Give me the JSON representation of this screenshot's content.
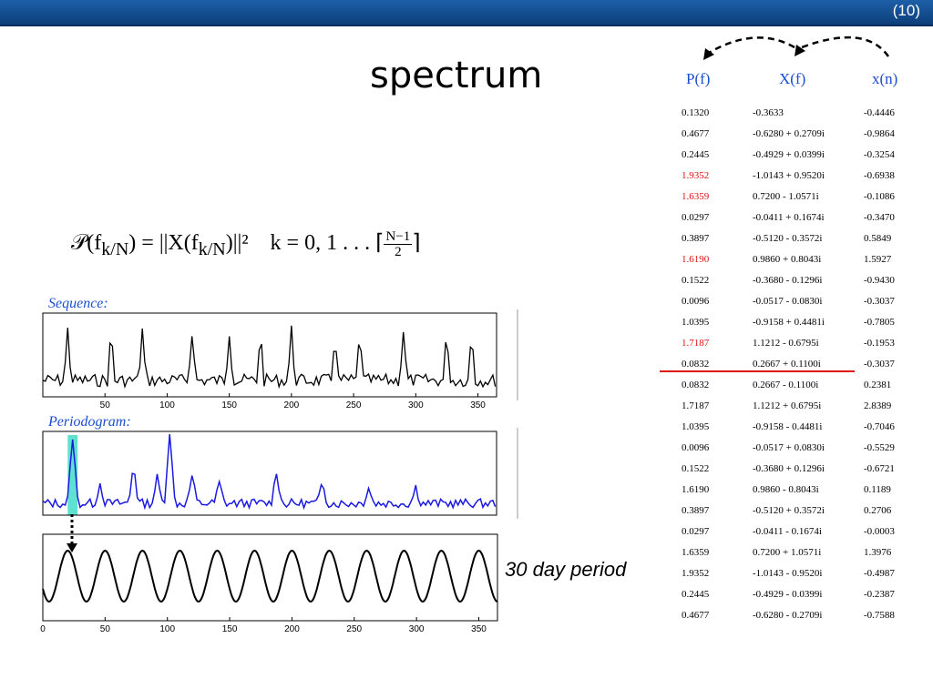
{
  "slide_number": "(10)",
  "title": "spectrum",
  "formula": {
    "lhs": "𝒫(f",
    "lhs_sub": "k/N",
    "mid": ") = ||X(f",
    "mid_sub": "k/N",
    "rhs": ")||²",
    "k_text": "k = 0, 1 . . . ⌈",
    "frac_num": "N−1",
    "frac_den": "2",
    "close": "⌉"
  },
  "sequence_label": "Sequence:",
  "periodogram_label": "Periodogram:",
  "caption": "30 day period",
  "table": {
    "headers": [
      "P(f)",
      "X(f)",
      "x(n)"
    ],
    "highlight_rows": [
      3,
      4,
      7,
      11
    ],
    "rows": [
      [
        "0.1320",
        "-0.3633",
        "-0.4446"
      ],
      [
        "0.4677",
        "-0.6280 + 0.2709i",
        "-0.9864"
      ],
      [
        "0.2445",
        "-0.4929 + 0.0399i",
        "-0.3254"
      ],
      [
        "1.9352",
        "-1.0143 + 0.9520i",
        "-0.6938"
      ],
      [
        "1.6359",
        "0.7200 - 1.0571i",
        "-0.1086"
      ],
      [
        "0.0297",
        "-0.0411 + 0.1674i",
        "-0.3470"
      ],
      [
        "0.3897",
        "-0.5120 - 0.3572i",
        "0.5849"
      ],
      [
        "1.6190",
        "0.9860 + 0.8043i",
        "1.5927"
      ],
      [
        "0.1522",
        "-0.3680 - 0.1296i",
        "-0.9430"
      ],
      [
        "0.0096",
        "-0.0517 - 0.0830i",
        "-0.3037"
      ],
      [
        "1.0395",
        "-0.9158 + 0.4481i",
        "-0.7805"
      ],
      [
        "1.7187",
        "1.1212 - 0.6795i",
        "-0.1953"
      ],
      [
        "0.0832",
        "0.2667 + 0.1100i",
        "-0.3037"
      ],
      [
        "0.0832",
        "0.2667 - 0.1100i",
        "0.2381"
      ],
      [
        "1.7187",
        "1.1212 + 0.6795i",
        "2.8389"
      ],
      [
        "1.0395",
        "-0.9158 - 0.4481i",
        "-0.7046"
      ],
      [
        "0.0096",
        "-0.0517 + 0.0830i",
        "-0.5529"
      ],
      [
        "0.1522",
        "-0.3680 + 0.1296i",
        "-0.6721"
      ],
      [
        "1.6190",
        "0.9860 - 0.8043i",
        "0.1189"
      ],
      [
        "0.3897",
        "-0.5120 + 0.3572i",
        "0.2706"
      ],
      [
        "0.0297",
        "-0.0411 - 0.1674i",
        "-0.0003"
      ],
      [
        "1.6359",
        "0.7200 + 1.0571i",
        "1.3976"
      ],
      [
        "1.9352",
        "-1.0143 - 0.9520i",
        "-0.4987"
      ],
      [
        "0.2445",
        "-0.4929 - 0.0399i",
        "-0.2387"
      ],
      [
        "0.4677",
        "-0.6280 - 0.2709i",
        "-0.7588"
      ]
    ]
  },
  "colors": {
    "header_blue": "#1a4fd0",
    "highlight_red": "#e01010",
    "periodogram_line": "#1a1ae0",
    "highlight_band": "#60e0d0"
  },
  "chart_data": [
    {
      "type": "line",
      "name_label": "Sequence:",
      "xlim": [
        0,
        365
      ],
      "x_ticks": [
        50,
        100,
        150,
        200,
        250,
        300,
        350
      ],
      "series": [
        {
          "peaks_x": [
            20,
            55,
            80,
            120,
            150,
            175,
            200,
            235,
            255,
            290,
            325,
            345
          ]
        }
      ]
    },
    {
      "type": "line",
      "name_label": "Periodogram:",
      "xlim": [
        0,
        365
      ],
      "highlight_x": [
        20,
        28
      ],
      "series": [
        {
          "peaks_x": [
            24,
            46,
            73,
            92,
            102,
            120,
            142,
            188,
            225,
            262,
            300
          ]
        }
      ]
    },
    {
      "type": "line",
      "xlim": [
        0,
        365
      ],
      "x_ticks": [
        0,
        50,
        100,
        150,
        200,
        250,
        300,
        350
      ],
      "series": [
        {
          "period_days": 30
        }
      ]
    }
  ]
}
